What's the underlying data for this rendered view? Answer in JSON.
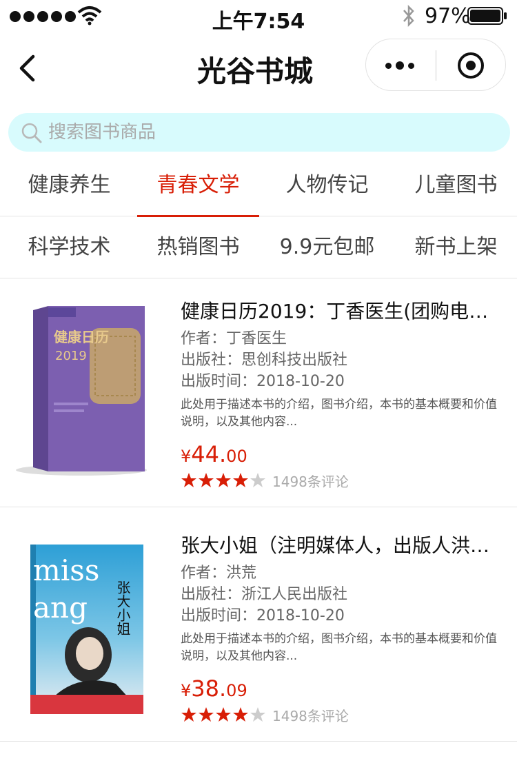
{
  "status_bar": {
    "time": "上午7:54",
    "battery_percent": "97%"
  },
  "nav": {
    "title": "光谷书城"
  },
  "search": {
    "placeholder": "搜索图书商品"
  },
  "categories": {
    "row1": [
      "健康养生",
      "青春文学",
      "人物传记",
      "儿童图书"
    ],
    "row2": [
      "科学技术",
      "热销图书",
      "9.9元包邮",
      "新书上架"
    ],
    "active": "青春文学"
  },
  "books": [
    {
      "title": "健康日历2019：丁香医生(团购电话…",
      "author": "作者：丁香医生",
      "publisher": "出版社：思创科技出版社",
      "pub_date": "出版时间：2018-10-20",
      "description": "此处用于描述本书的介绍，图书介绍，本书的基本概要和价值说明，以及其他内容...",
      "price_symbol": "¥",
      "price_int": "44.",
      "price_dec": "00",
      "rating": 4,
      "reviews": "1498条评论",
      "cover": {
        "title": "健康日历",
        "year": "2019",
        "color": "#7c5fb0"
      }
    },
    {
      "title": "张大小姐（注明媒体人，出版人洪…",
      "author": "作者：洪荒",
      "publisher": "出版社：浙江人民出版社",
      "pub_date": "出版时间：2018-10-20",
      "description": "此处用于描述本书的介绍，图书介绍，本书的基本概要和价值说明，以及其他内容...",
      "price_symbol": "¥",
      "price_int": "38.",
      "price_dec": "09",
      "rating": 4,
      "reviews": "1498条评论",
      "cover": {
        "title": "张大小姐",
        "big_text_1": "miss",
        "big_text_2": "ang",
        "color": "#3aa7d8"
      }
    }
  ],
  "colors": {
    "accent": "#d81e06",
    "search_bg": "#d8fbfd",
    "star_off": "#cccccc"
  }
}
